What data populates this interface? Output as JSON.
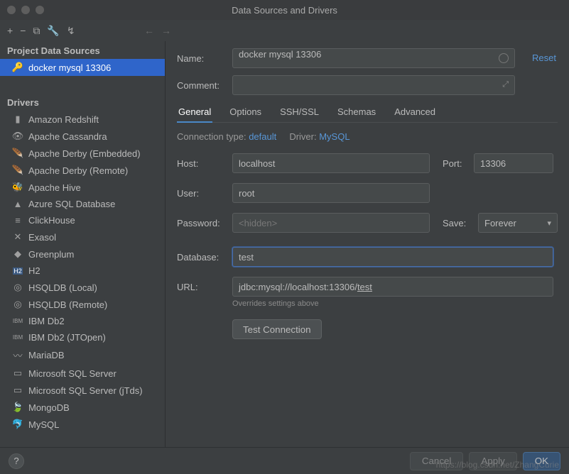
{
  "window": {
    "title": "Data Sources and Drivers"
  },
  "toolbar": {
    "add": "+",
    "remove": "−",
    "copy": "⧉",
    "settings": "🔧",
    "make": "↯",
    "back": "←",
    "forward": "→"
  },
  "sidebar": {
    "project_header": "Project Data Sources",
    "selected_ds": "docker mysql 13306",
    "drivers_header": "Drivers",
    "drivers": [
      "Amazon Redshift",
      "Apache Cassandra",
      "Apache Derby (Embedded)",
      "Apache Derby (Remote)",
      "Apache Hive",
      "Azure SQL Database",
      "ClickHouse",
      "Exasol",
      "Greenplum",
      "H2",
      "HSQLDB (Local)",
      "HSQLDB (Remote)",
      "IBM Db2",
      "IBM Db2 (JTOpen)",
      "MariaDB",
      "Microsoft SQL Server",
      "Microsoft SQL Server (jTds)",
      "MongoDB",
      "MySQL"
    ]
  },
  "form": {
    "reset": "Reset",
    "name_label": "Name:",
    "name_value": "docker mysql 13306",
    "comment_label": "Comment:",
    "tabs": [
      "General",
      "Options",
      "SSH/SSL",
      "Schemas",
      "Advanced"
    ],
    "conn_type_label": "Connection type:",
    "conn_type_value": "default",
    "driver_label": "Driver:",
    "driver_value": "MySQL",
    "host_label": "Host:",
    "host_value": "localhost",
    "port_label": "Port:",
    "port_value": "13306",
    "user_label": "User:",
    "user_value": "root",
    "password_label": "Password:",
    "password_placeholder": "<hidden>",
    "save_label": "Save:",
    "save_value": "Forever",
    "database_label": "Database:",
    "database_value": "test",
    "url_label": "URL:",
    "url_prefix": "jdbc:mysql://localhost:13306/",
    "url_suffix": "test",
    "url_hint": "Overrides settings above",
    "test_btn": "Test Connection"
  },
  "footer": {
    "help": "?",
    "cancel": "Cancel",
    "apply": "Apply",
    "ok": "OK"
  },
  "watermark": "https://blog.csdn.net/ZhangCurie"
}
